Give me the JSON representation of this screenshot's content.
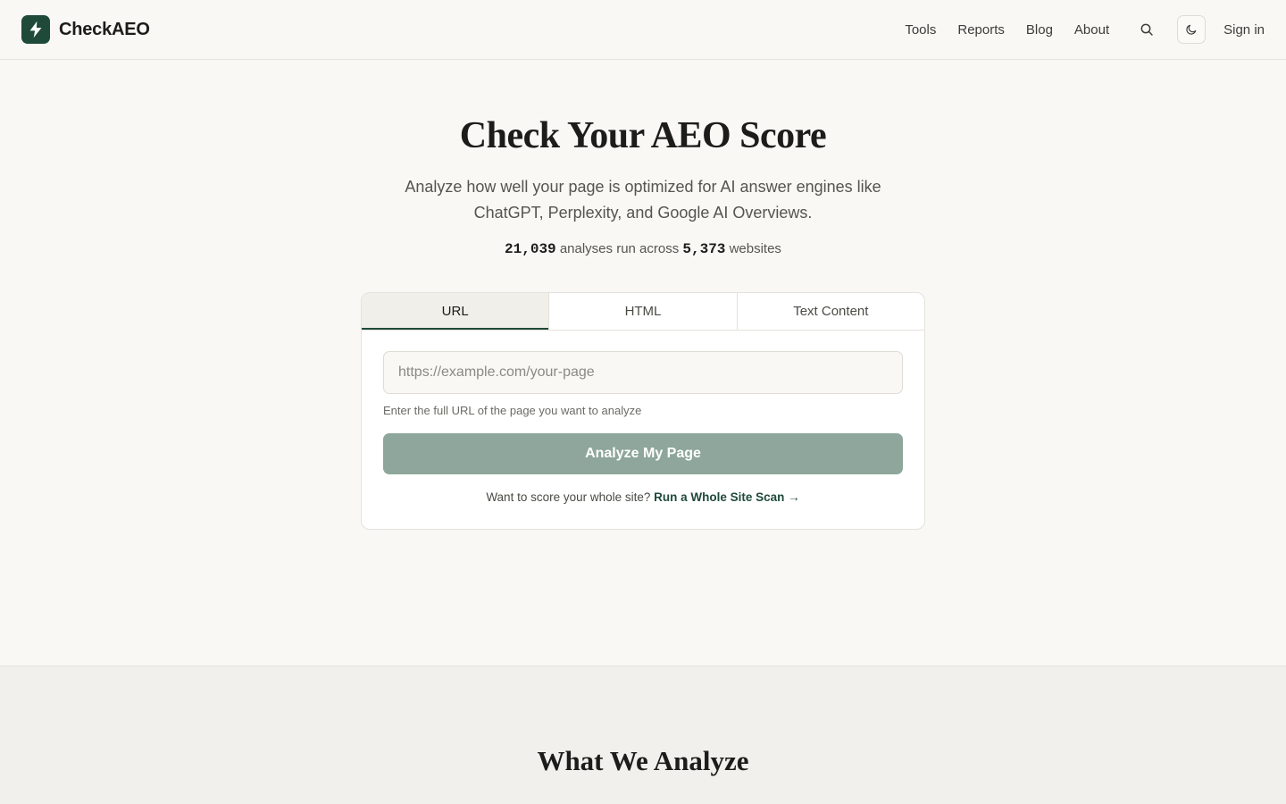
{
  "header": {
    "brand": "CheckAEO",
    "nav": [
      "Tools",
      "Reports",
      "Blog",
      "About"
    ],
    "sign_in": "Sign in"
  },
  "hero": {
    "title": "Check Your AEO Score",
    "subtitle": "Analyze how well your page is optimized for AI answer engines like ChatGPT, Perplexity, and Google AI Overviews.",
    "stats": {
      "analyses": "21,039",
      "analyses_label": " analyses run across ",
      "websites": "5,373",
      "websites_label": " websites"
    }
  },
  "analyzer": {
    "tabs": [
      "URL",
      "HTML",
      "Text Content"
    ],
    "active_tab": "URL",
    "input_value": "",
    "input_placeholder": "https://example.com/your-page",
    "hint": "Enter the full URL of the page you want to analyze",
    "button_label": "Analyze My Page",
    "whole_site_prompt": "Want to score your whole site? ",
    "whole_site_link": "Run a Whole Site Scan →"
  },
  "section2": {
    "title": "What We Analyze"
  },
  "colors": {
    "brand": "#1f4a3a",
    "button_disabled": "#8ea69b",
    "background": "#f9f8f5"
  },
  "icons": {
    "logo": "lightning-bolt-icon",
    "search": "search-icon",
    "theme": "moon-icon"
  }
}
